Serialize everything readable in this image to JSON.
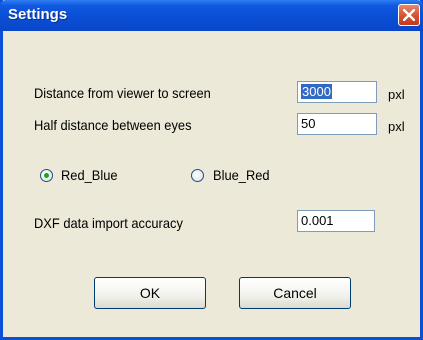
{
  "window": {
    "title": "Settings"
  },
  "fields": {
    "distance": {
      "label": "Distance from viewer to screen",
      "value": "3000",
      "unit": "pxl"
    },
    "half_eyes": {
      "label": "Half distance between eyes",
      "value": "50",
      "unit": "pxl"
    },
    "dxf": {
      "label": "DXF data import accuracy",
      "value": "0.001"
    }
  },
  "radios": {
    "red_blue": {
      "label": "Red_Blue",
      "checked": true
    },
    "blue_red": {
      "label": "Blue_Red",
      "checked": false
    }
  },
  "buttons": {
    "ok": "OK",
    "cancel": "Cancel"
  },
  "colors": {
    "titlebar": "#0a4fd6",
    "dialog_bg": "#ece9d8",
    "close_button": "#d24d2e"
  }
}
